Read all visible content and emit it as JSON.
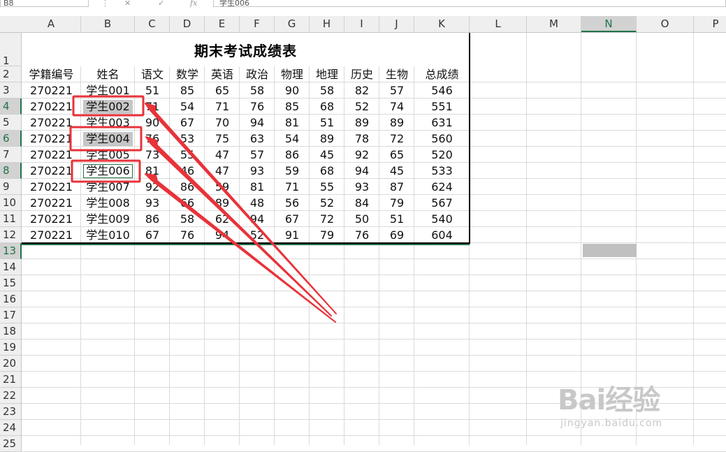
{
  "toolbar": {
    "namebox_value": "B8",
    "fx_label": "fx",
    "formula_value": "学生006"
  },
  "columns": [
    {
      "letter": "A",
      "width": 85
    },
    {
      "letter": "B",
      "width": 77
    },
    {
      "letter": "C",
      "width": 50
    },
    {
      "letter": "D",
      "width": 50
    },
    {
      "letter": "E",
      "width": 50
    },
    {
      "letter": "F",
      "width": 50
    },
    {
      "letter": "G",
      "width": 50
    },
    {
      "letter": "H",
      "width": 50
    },
    {
      "letter": "I",
      "width": 50
    },
    {
      "letter": "J",
      "width": 50
    },
    {
      "letter": "K",
      "width": 79
    },
    {
      "letter": "L",
      "width": 82
    },
    {
      "letter": "M",
      "width": 78
    },
    {
      "letter": "N",
      "width": 79
    },
    {
      "letter": "O",
      "width": 82
    },
    {
      "letter": "P",
      "width": 63
    }
  ],
  "selected_column": "N",
  "rows": [
    "1",
    "2",
    "3",
    "4",
    "5",
    "6",
    "7",
    "8",
    "9",
    "10",
    "11",
    "12",
    "13",
    "14",
    "15",
    "16",
    "17",
    "18",
    "19",
    "20",
    "21",
    "22",
    "23",
    "24",
    "25"
  ],
  "selected_rows": [
    "4",
    "6",
    "8",
    "13"
  ],
  "sheet": {
    "title": "期末考试成绩表",
    "headers": [
      "学籍编号",
      "姓名",
      "语文",
      "数学",
      "英语",
      "政治",
      "物理",
      "地理",
      "历史",
      "生物",
      "总成绩"
    ],
    "data": [
      [
        "270221",
        "学生001",
        "51",
        "85",
        "65",
        "58",
        "90",
        "58",
        "82",
        "57",
        "546"
      ],
      [
        "270221",
        "学生002",
        "71",
        "54",
        "71",
        "76",
        "85",
        "68",
        "52",
        "74",
        "551"
      ],
      [
        "270221",
        "学生003",
        "90",
        "67",
        "70",
        "94",
        "81",
        "51",
        "89",
        "89",
        "631"
      ],
      [
        "270221",
        "学生004",
        "76",
        "53",
        "75",
        "63",
        "54",
        "89",
        "78",
        "72",
        "560"
      ],
      [
        "270221",
        "学生005",
        "73",
        "55",
        "47",
        "57",
        "86",
        "45",
        "92",
        "65",
        "520"
      ],
      [
        "270221",
        "学生006",
        "81",
        "46",
        "47",
        "93",
        "59",
        "68",
        "94",
        "45",
        "533"
      ],
      [
        "270221",
        "学生007",
        "92",
        "86",
        "59",
        "81",
        "71",
        "55",
        "93",
        "87",
        "624"
      ],
      [
        "270221",
        "学生008",
        "93",
        "66",
        "89",
        "48",
        "56",
        "52",
        "84",
        "79",
        "567"
      ],
      [
        "270221",
        "学生009",
        "86",
        "58",
        "62",
        "94",
        "67",
        "72",
        "50",
        "51",
        "540"
      ],
      [
        "270221",
        "学生010",
        "67",
        "76",
        "94",
        "52",
        "91",
        "79",
        "76",
        "69",
        "604"
      ]
    ]
  },
  "highlighted_names": [
    "学生002",
    "学生004",
    "学生006"
  ],
  "colors": {
    "annotation_red": "#e8333a",
    "selection_green": "#217346",
    "highlight_gray": "#c6c6c6"
  },
  "watermark": {
    "logo": "Bai经验",
    "url": "jingyan.baidu.com"
  }
}
